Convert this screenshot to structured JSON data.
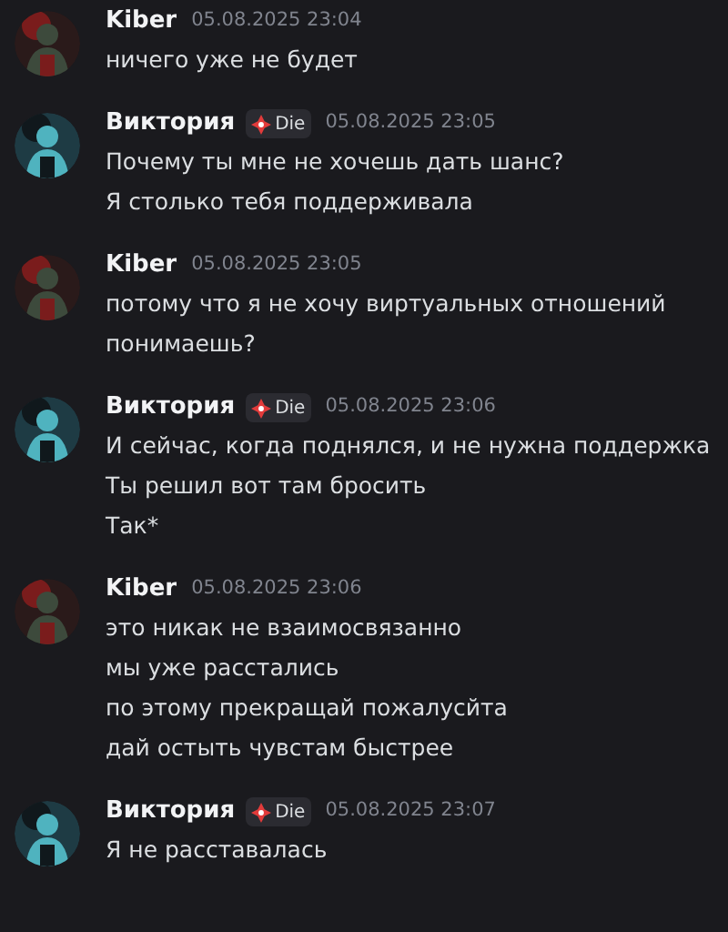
{
  "messages": [
    {
      "author": "Kiber",
      "time": "05.08.2025 23:04",
      "avatar": {
        "kind": "picture"
      },
      "lines": [
        "ничего уже не будет"
      ]
    },
    {
      "author": "Виктория",
      "badge": "Die",
      "time": "05.08.2025 23:05",
      "avatar": {
        "kind": "picture"
      },
      "lines": [
        "Почему ты мне не хочешь дать шанс?",
        "Я столько тебя поддерживала"
      ]
    },
    {
      "author": "Kiber",
      "time": "05.08.2025 23:05",
      "avatar": {
        "kind": "picture"
      },
      "lines": [
        "потому что я не хочу виртуальных отношений",
        "понимаешь?"
      ]
    },
    {
      "author": "Виктория",
      "badge": "Die",
      "time": "05.08.2025 23:06",
      "avatar": {
        "kind": "picture"
      },
      "lines": [
        "И сейчас, когда поднялся, и не нужна поддержка",
        "Ты решил вот там бросить",
        "Так*"
      ]
    },
    {
      "author": "Kiber",
      "time": "05.08.2025 23:06",
      "avatar": {
        "kind": "picture"
      },
      "lines": [
        "это никак не взаимосвязанно",
        "мы уже расстались",
        "по этому прекращай пожалусйта",
        "дай остыть чувстам быстрее"
      ]
    },
    {
      "author": "Виктория",
      "badge": "Die",
      "time": "05.08.2025 23:07",
      "avatar": {
        "kind": "picture"
      },
      "lines": [
        "Я не расставалась"
      ]
    }
  ]
}
